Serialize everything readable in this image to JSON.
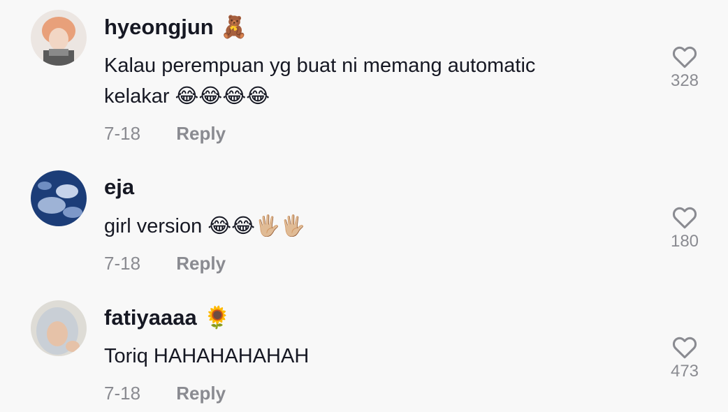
{
  "comments": [
    {
      "username": "hyeongjun",
      "username_emoji": "🧸",
      "text": "Kalau perempuan yg buat ni memang automatic kelakar 😂😂😂😂",
      "date": "7-18",
      "reply_label": "Reply",
      "likes": "328"
    },
    {
      "username": "eja",
      "username_emoji": "",
      "text": "girl version 😂😂🖐🏼🖐🏼",
      "date": "7-18",
      "reply_label": "Reply",
      "likes": "180"
    },
    {
      "username": "fatiyaaaa",
      "username_emoji": "🌻",
      "text": "Toriq HAHAHAHAHAH",
      "date": "7-18",
      "reply_label": "Reply",
      "likes": "473"
    }
  ],
  "colors": {
    "background": "#f8f8f8",
    "primary_text": "#161823",
    "secondary_text": "#8a8b91"
  },
  "icons": {
    "like": "heart-outline-icon"
  }
}
